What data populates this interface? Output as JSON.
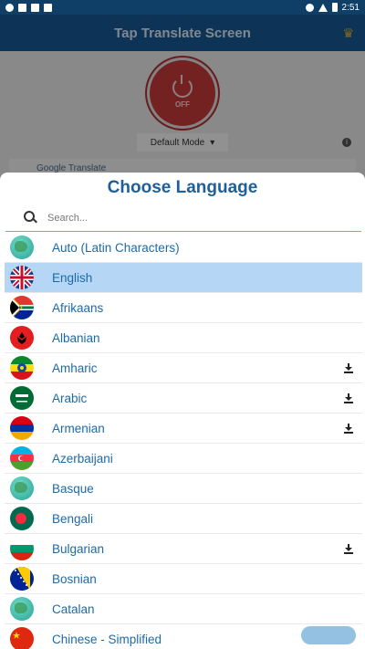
{
  "app": {
    "title": "Tap Translate Screen"
  },
  "background": {
    "power_label": "OFF",
    "mode": "Default Mode",
    "engine": "Google Translate"
  },
  "sheet": {
    "title": "Choose Language",
    "search_placeholder": "Search...",
    "languages": [
      {
        "name": "Auto (Latin Characters)",
        "flag": "globe",
        "download": false,
        "selected": false
      },
      {
        "name": "English",
        "flag": "uk",
        "download": false,
        "selected": true
      },
      {
        "name": "Afrikaans",
        "flag": "za",
        "download": false,
        "selected": false
      },
      {
        "name": "Albanian",
        "flag": "al",
        "download": false,
        "selected": false
      },
      {
        "name": "Amharic",
        "flag": "et",
        "download": true,
        "selected": false
      },
      {
        "name": "Arabic",
        "flag": "sa",
        "download": true,
        "selected": false
      },
      {
        "name": "Armenian",
        "flag": "am",
        "download": true,
        "selected": false
      },
      {
        "name": "Azerbaijani",
        "flag": "az",
        "download": false,
        "selected": false
      },
      {
        "name": "Basque",
        "flag": "globe",
        "download": false,
        "selected": false
      },
      {
        "name": "Bengali",
        "flag": "bd",
        "download": false,
        "selected": false
      },
      {
        "name": "Bulgarian",
        "flag": "bg",
        "download": true,
        "selected": false
      },
      {
        "name": "Bosnian",
        "flag": "ba",
        "download": false,
        "selected": false
      },
      {
        "name": "Catalan",
        "flag": "globe",
        "download": false,
        "selected": false
      },
      {
        "name": "Chinese - Simplified",
        "flag": "cn",
        "download": false,
        "selected": false
      }
    ]
  },
  "status_bar": {
    "time": "2:51"
  },
  "colors": {
    "accent": "#1f5f9a",
    "selected_row": "#b5d6f5"
  }
}
